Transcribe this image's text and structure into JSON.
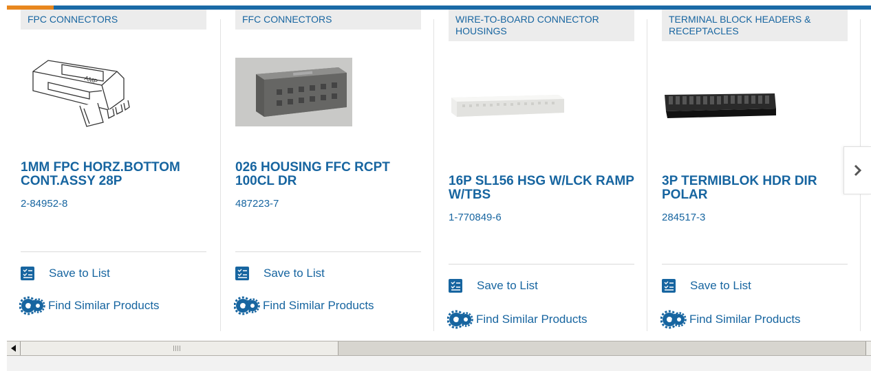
{
  "colors": {
    "accent": "#e8871e",
    "brand_blue": "#1a6aa6",
    "link": "#1765a0"
  },
  "cards": [
    {
      "category": "FPC CONNECTORS",
      "title": "1MM FPC HORZ.BOTTOM CONT.ASSY 28P",
      "part_number": "2-84952-8",
      "save_label": "Save to List",
      "similar_label": "Find Similar Products",
      "image": "fpc-connector-drawing"
    },
    {
      "category": "FFC CONNECTORS",
      "title": "026 HOUSING FFC RCPT 100CL DR",
      "part_number": "487223-7",
      "save_label": "Save to List",
      "similar_label": "Find Similar Products",
      "image": "ffc-housing-photo"
    },
    {
      "category": "WIRE-TO-BOARD CONNECTOR HOUSINGS",
      "title": "16P SL156 HSG W/LCK RAMP W/TBS",
      "part_number": "1-770849-6",
      "save_label": "Save to List",
      "similar_label": "Find Similar Products",
      "image": "wire-to-board-housing-photo"
    },
    {
      "category": "TERMINAL BLOCK HEADERS & RECEPTACLES",
      "title": "3P TERMIBLOK HDR DIR POLAR",
      "part_number": "284517-3",
      "save_label": "Save to List",
      "similar_label": "Find Similar Products",
      "image": "terminal-block-header-photo"
    }
  ],
  "carousel": {
    "next_icon": "chevron-right-icon"
  },
  "scrollbar": {
    "left_icon": "arrow-left-icon",
    "right_icon": "arrow-right-icon"
  }
}
